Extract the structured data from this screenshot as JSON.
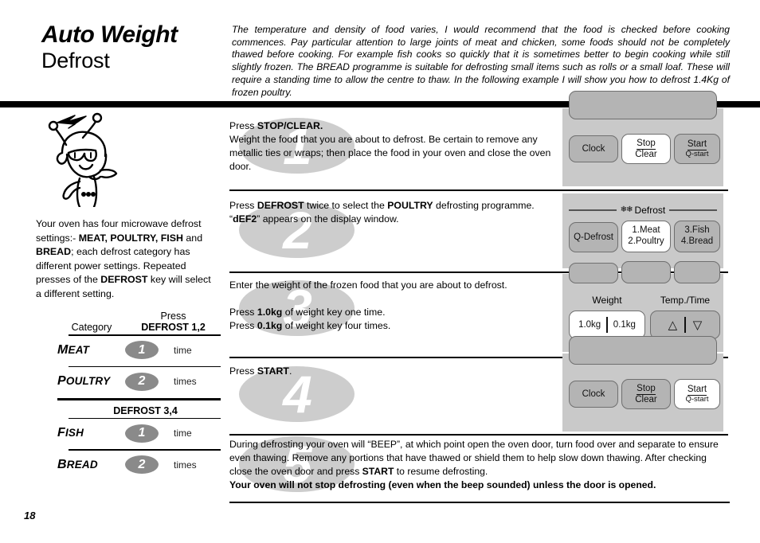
{
  "header": {
    "title_line1": "Auto Weight",
    "title_line2": "Defrost",
    "intro": "The temperature and density of food varies, I would recommend that the food is checked before cooking commences. Pay particular attention to large joints of meat and chicken, some foods should not be completely thawed before cooking. For example fish cooks so quickly that it is sometimes better to begin cooking while still slightly frozen. The BREAD programme is suitable for defrosting small items such as rolls or a small loaf. These will require a standing time to allow the centre to thaw. In the following example I will show you how to defrost 1.4Kg of frozen poultry."
  },
  "sidebar": {
    "intro_html": "Your oven has four microwave defrost settings:- <b>MEAT, POULTRY, FISH</b> and <b>BREAD</b>; each defrost category has different power settings. Repeated presses of the <b>DEFROST</b> key will select a different setting.",
    "table": {
      "col1_header": "Category",
      "col2_header_top": "Press",
      "col2_header_bottom": "DEFROST 1,2",
      "subhead": "DEFROST 3,4",
      "rows": [
        {
          "category_first": "M",
          "category_rest": "EAT",
          "count": "1",
          "times": "time"
        },
        {
          "category_first": "P",
          "category_rest": "OULTRY",
          "count": "2",
          "times": "times"
        },
        {
          "category_first": "F",
          "category_rest": "ISH",
          "count": "1",
          "times": "time"
        },
        {
          "category_first": "B",
          "category_rest": "READ",
          "count": "2",
          "times": "times"
        }
      ]
    }
  },
  "steps": [
    {
      "number": "1",
      "text_html": "Press <b>STOP/CLEAR.</b><br>Weight the food that you are about to defrost. Be certain to remove any metallic ties or wraps; then place the food in your oven and close the oven door.",
      "panel": {
        "type": "clock-stop-start",
        "buttons": [
          {
            "name": "clock",
            "label": "Clock",
            "highlighted": false
          },
          {
            "name": "stop-clear",
            "label_top": "Stop",
            "label_bottom": "Clear",
            "highlighted": true
          },
          {
            "name": "start-qstart",
            "label_top": "Start",
            "label_bottom": "Q-start",
            "highlighted": false
          }
        ]
      }
    },
    {
      "number": "2",
      "text_html": "Press <b>DEFROST</b> twice to select the <b>POULTRY</b> defrosting programme.<br>“<b>dEF2</b>” appears on the display window.",
      "panel": {
        "type": "defrost",
        "group_label": "Defrost",
        "snowflake": "❄",
        "buttons": [
          {
            "name": "q-defrost",
            "label": "Q-Defrost",
            "highlighted": false
          },
          {
            "name": "meat-poultry",
            "label_top": "1.Meat",
            "label_bottom": "2.Poultry",
            "highlighted": true
          },
          {
            "name": "fish-bread",
            "label_top": "3.Fish",
            "label_bottom": "4.Bread",
            "highlighted": false
          }
        ]
      }
    },
    {
      "number": "3",
      "text_html": "Enter the weight of the frozen food that you are about to defrost.<br><br>Press <b>1.0kg</b> of weight key one time.<br>Press <b>0.1kg</b> of weight key four times.",
      "panel": {
        "type": "weight",
        "weight_label": "Weight",
        "temp_time_label": "Temp./Time",
        "weight_buttons": [
          "1.0kg",
          "0.1kg"
        ],
        "weight_highlighted": true,
        "arrow_up": "△",
        "arrow_down": "▽"
      }
    },
    {
      "number": "4",
      "text_html": "Press <b>START</b>.",
      "panel": {
        "type": "clock-stop-start",
        "buttons": [
          {
            "name": "clock",
            "label": "Clock",
            "highlighted": false
          },
          {
            "name": "stop-clear",
            "label_top": "Stop",
            "label_bottom": "Clear",
            "highlighted": false
          },
          {
            "name": "start-qstart",
            "label_top": "Start",
            "label_bottom": "Q-start",
            "highlighted": true
          }
        ]
      }
    }
  ],
  "bottom": {
    "watermark_number": "5",
    "note_html": "During defrosting your oven will “BEEP”, at which point open the oven door, turn food over and separate to ensure even thawing. Remove any portions that have thawed or shield them to help slow down thawing. After checking close the oven door and press <b>START</b> to resume defrosting.<br><b>Your oven will not stop defrosting (even when the beep sounded) unless the door is opened.</b>"
  },
  "page_number": "18",
  "colors": {
    "panel_bg": "#c9c9c9",
    "button_bg": "#b4b4b4",
    "button_highlight": "#ffffff",
    "badge_gray": "#8a8a8a",
    "watermark_gray": "#cdcdcd"
  }
}
